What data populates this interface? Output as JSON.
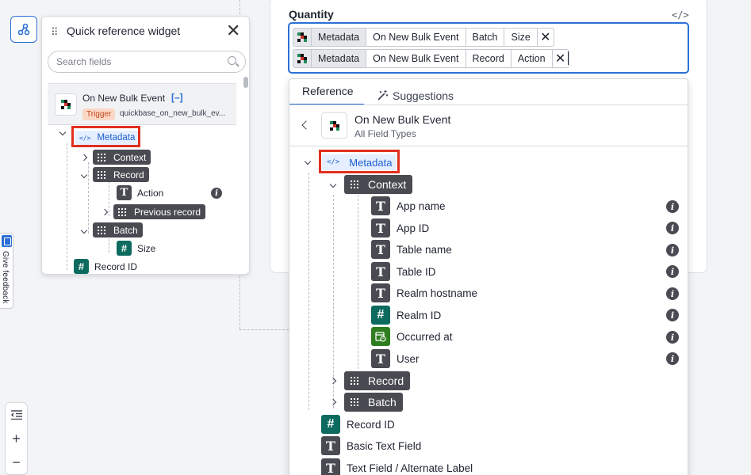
{
  "colors": {
    "accent": "#2b6fd6",
    "highlight": "#e0301e",
    "trigger_badge_bg": "#fbd8c6",
    "number_icon": "#0c6b5e",
    "date_icon": "#2e7d1f",
    "tag_dark": "#4a4b52"
  },
  "left_rail": {
    "flow_icon": "flow-icon",
    "feedback_label": "Give feedback",
    "zoom": {
      "collapse_icon": "indent-icon",
      "zoom_in": "+",
      "zoom_out": "−"
    }
  },
  "widget": {
    "drag_handle": "⠿",
    "title": "Quick reference widget",
    "close": "✕",
    "search_placeholder": "Search fields",
    "card": {
      "name": "On New Bulk Event",
      "bracket": "[–]",
      "badge": "Trigger",
      "sub": "quickbase_on_new_bulk_ev..."
    },
    "tree": {
      "metadata": "Metadata",
      "context": "Context",
      "record": "Record",
      "action": "Action",
      "previous_record": "Previous record",
      "batch": "Batch",
      "size": "Size",
      "record_id": "Record ID"
    }
  },
  "main": {
    "quantity_label": "Quantity",
    "code_toggle": "</>",
    "pill_rows": [
      {
        "segments": [
          "Metadata",
          "On New Bulk Event",
          "Batch",
          "Size"
        ],
        "remove": "✕"
      },
      {
        "segments": [
          "Metadata",
          "On New Bulk Event",
          "Record",
          "Action"
        ],
        "remove": "✕"
      }
    ]
  },
  "dropdown": {
    "tabs": {
      "reference": "Reference",
      "suggestions": "Suggestions"
    },
    "header_title": "On New Bulk Event",
    "header_sub": "All Field Types",
    "metadata": "Metadata",
    "context": "Context",
    "context_fields": [
      "App name",
      "App ID",
      "Table name",
      "Table ID",
      "Realm hostname",
      "Realm ID",
      "Occurred at",
      "User"
    ],
    "record": "Record",
    "batch": "Batch",
    "fields": [
      "Record ID",
      "Basic Text Field",
      "Text Field / Alternate Label"
    ]
  }
}
